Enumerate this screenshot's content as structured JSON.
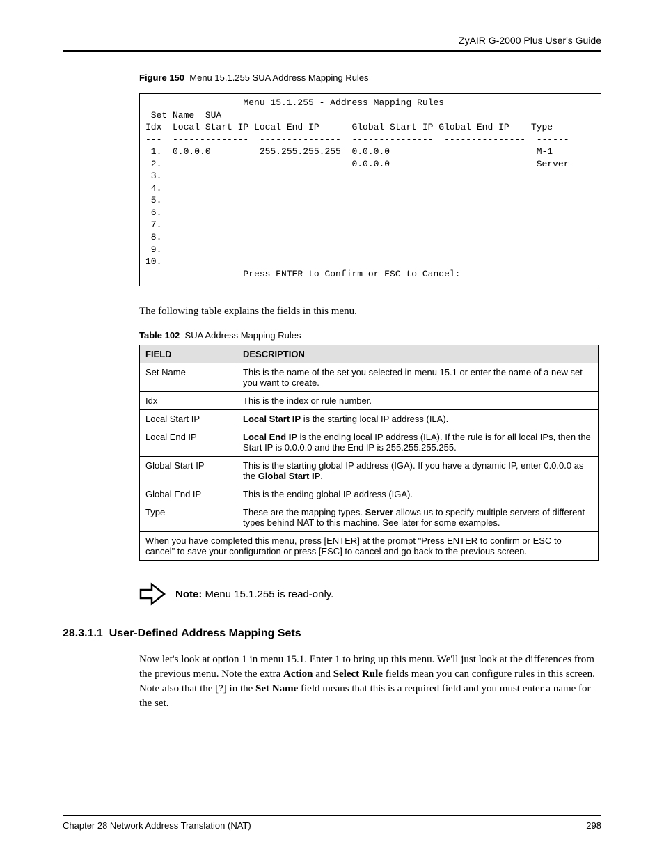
{
  "header": {
    "guide_title": "ZyAIR G-2000 Plus User's Guide"
  },
  "figure": {
    "label": "Figure 150",
    "title": "Menu 15.1.255 SUA Address Mapping Rules"
  },
  "terminal": {
    "title": "Menu 15.1.255 - Address Mapping Rules",
    "set_name_label": "Set Name=",
    "set_name_value": "SUA",
    "columns": {
      "idx": "Idx",
      "lstart": "Local Start IP",
      "lend": "Local End IP",
      "gstart": "Global Start IP",
      "gend": "Global End IP",
      "type": "Type"
    },
    "rows": [
      {
        "idx": "1.",
        "lstart": "0.0.0.0",
        "lend": "255.255.255.255",
        "gstart": "0.0.0.0",
        "gend": "",
        "type": "M-1"
      },
      {
        "idx": "2.",
        "lstart": "",
        "lend": "",
        "gstart": "0.0.0.0",
        "gend": "",
        "type": "Server"
      },
      {
        "idx": "3.",
        "lstart": "",
        "lend": "",
        "gstart": "",
        "gend": "",
        "type": ""
      },
      {
        "idx": "4.",
        "lstart": "",
        "lend": "",
        "gstart": "",
        "gend": "",
        "type": ""
      },
      {
        "idx": "5.",
        "lstart": "",
        "lend": "",
        "gstart": "",
        "gend": "",
        "type": ""
      },
      {
        "idx": "6.",
        "lstart": "",
        "lend": "",
        "gstart": "",
        "gend": "",
        "type": ""
      },
      {
        "idx": "7.",
        "lstart": "",
        "lend": "",
        "gstart": "",
        "gend": "",
        "type": ""
      },
      {
        "idx": "8.",
        "lstart": "",
        "lend": "",
        "gstart": "",
        "gend": "",
        "type": ""
      },
      {
        "idx": "9.",
        "lstart": "",
        "lend": "",
        "gstart": "",
        "gend": "",
        "type": ""
      },
      {
        "idx": "10.",
        "lstart": "",
        "lend": "",
        "gstart": "",
        "gend": "",
        "type": ""
      }
    ],
    "prompt": "Press ENTER to Confirm or ESC to Cancel:"
  },
  "intro_text": "The following table explains the fields in this menu.",
  "table": {
    "label": "Table 102",
    "title": "SUA Address Mapping Rules",
    "headers": {
      "field": "FIELD",
      "desc": "DESCRIPTION"
    },
    "rows": [
      {
        "field": "Set Name",
        "desc_plain": "This is the name of the set you selected in menu 15.1 or enter the name of a new set you want to create."
      },
      {
        "field": "Idx",
        "desc_plain": "This is the index or rule number."
      },
      {
        "field": "Local Start IP",
        "desc_bold1": "Local Start IP",
        "desc_rest": " is the starting local IP address (ILA)."
      },
      {
        "field": "Local End IP",
        "desc_bold1": "Local End IP",
        "desc_rest": " is the ending local IP address (ILA). If the rule is for all local IPs, then the Start IP is 0.0.0.0 and the End IP is 255.255.255.255."
      },
      {
        "field": "Global Start IP",
        "desc_pre": "This is the starting global IP address (IGA). If you have a dynamic IP, enter 0.0.0.0 as the ",
        "desc_bold": "Global Start IP",
        "desc_post": "."
      },
      {
        "field": "Global End IP",
        "desc_plain": "This is the ending global IP address (IGA)."
      },
      {
        "field": "Type",
        "desc_pre": "These are the mapping types. ",
        "desc_bold": "Server",
        "desc_post": " allows us to specify multiple servers of different types behind NAT to this machine. See later for some examples."
      }
    ],
    "footer": "When you have completed this menu, press [ENTER] at the prompt \"Press ENTER to confirm or ESC to cancel\" to save your configuration or press [ESC] to cancel and go back to the previous screen."
  },
  "note": {
    "label": "Note:",
    "text": " Menu 15.1.255 is read-only."
  },
  "section": {
    "number": "28.3.1.1",
    "title": "User-Defined Address Mapping Sets"
  },
  "body": {
    "p1_pre": "Now let's look at option 1 in menu 15.1. Enter 1 to bring up this menu. We'll just look at the differences from the previous menu. Note the extra ",
    "p1_b1": "Action",
    "p1_mid1": " and ",
    "p1_b2": "Select Rule",
    "p1_mid2": " fields mean you can configure rules in this screen. Note also that the [?] in the ",
    "p1_b3": "Set Name",
    "p1_post": " field means that this is a required field and you must enter a name for the set."
  },
  "footer": {
    "chapter": "Chapter 28 Network Address Translation (NAT)",
    "page": "298"
  },
  "chart_data": {
    "type": "table",
    "title": "SUA Address Mapping Rules",
    "columns": [
      "FIELD",
      "DESCRIPTION"
    ],
    "rows": [
      [
        "Set Name",
        "This is the name of the set you selected in menu 15.1 or enter the name of a new set you want to create."
      ],
      [
        "Idx",
        "This is the index or rule number."
      ],
      [
        "Local Start IP",
        "Local Start IP is the starting local IP address (ILA)."
      ],
      [
        "Local End IP",
        "Local End IP is the ending local IP address (ILA). If the rule is for all local IPs, then the Start IP is 0.0.0.0 and the End IP is 255.255.255.255."
      ],
      [
        "Global Start IP",
        "This is the starting global IP address (IGA). If you have a dynamic IP, enter 0.0.0.0 as the Global Start IP."
      ],
      [
        "Global End IP",
        "This is the ending global IP address (IGA)."
      ],
      [
        "Type",
        "These are the mapping types. Server allows us to specify multiple servers of different types behind NAT to this machine. See later for some examples."
      ]
    ]
  }
}
